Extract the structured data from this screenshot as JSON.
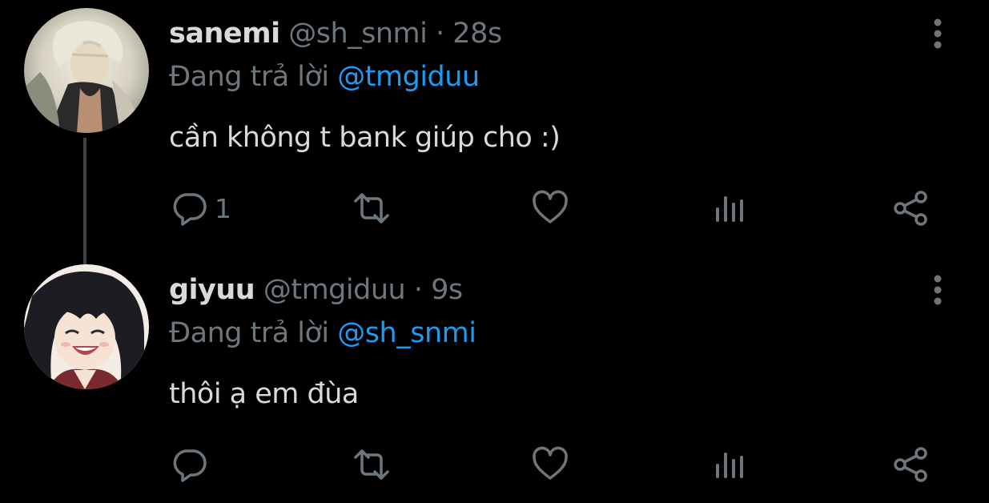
{
  "tweets": [
    {
      "name": "sanemi",
      "handle": "@sh_snmi",
      "dot": "·",
      "time": "28s",
      "replying_prefix": "Đang trả lời",
      "replying_to": "@tmgiduu",
      "text": "cần không t bank giúp cho :)",
      "reply_count": "1",
      "avatar_icon": "sanemi-avatar-icon"
    },
    {
      "name": "giyuu",
      "handle": "@tmgiduu",
      "dot": "·",
      "time": "9s",
      "replying_prefix": "Đang trả lời",
      "replying_to": "@sh_snmi",
      "text": "thôi ạ em đùa",
      "reply_count": "",
      "avatar_icon": "giyuu-avatar-icon"
    }
  ],
  "icons": {
    "reply": "reply-icon",
    "retweet": "retweet-icon",
    "like": "heart-icon",
    "analytics": "analytics-icon",
    "share": "share-icon",
    "more": "more-vertical-icon"
  },
  "colors": {
    "background": "#000000",
    "text": "#d9d9d9",
    "muted": "#6e767d",
    "link": "#1d9bf0",
    "thread_line": "#3d4248"
  }
}
